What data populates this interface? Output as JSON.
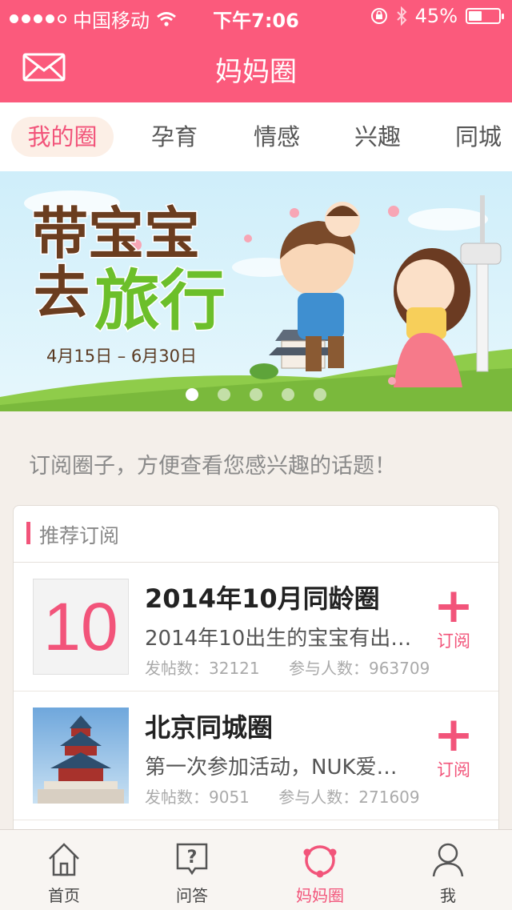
{
  "status": {
    "carrier": "中国移动",
    "time": "下午7:06",
    "battery": "45%"
  },
  "navbar": {
    "title": "妈妈圈"
  },
  "tabs": [
    "我的圈",
    "孕育",
    "情感",
    "兴趣",
    "同城"
  ],
  "banner": {
    "line1": "带宝宝",
    "line2a": "去",
    "line2b": "旅行",
    "date": "4月15日 – 6月30日",
    "pages": 5,
    "current_page": 1
  },
  "hint": "订阅圈子，方便查看您感兴趣的话题！",
  "recommend": {
    "header": "推荐订阅",
    "items": [
      {
        "thumb_text": "10",
        "title": "2014年10月同龄圈",
        "desc": "2014年10出生的宝宝有出…",
        "posts_label": "发帖数：32121",
        "members_label": "参与人数：963709",
        "subscribe": "订阅"
      },
      {
        "title": "北京同城圈",
        "desc": "第一次参加活动，NUK爱…",
        "posts_label": "发帖数：9051",
        "members_label": "参与人数：271609",
        "subscribe": "订阅"
      }
    ]
  },
  "tabbar": {
    "items": [
      "首页",
      "问答",
      "妈妈圈",
      "我"
    ],
    "active": "妈妈圈"
  },
  "colors": {
    "brand": "#fb5a7c",
    "accent": "#f2547a"
  }
}
